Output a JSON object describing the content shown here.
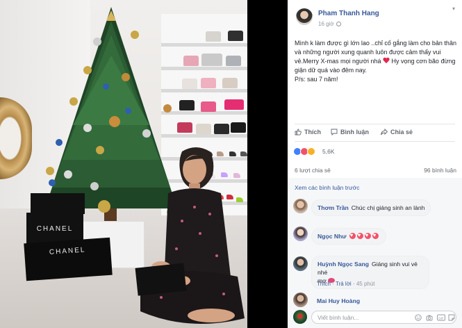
{
  "post": {
    "author": "Pham Thanh Hang",
    "time": "16 giờ",
    "body_lines": [
      "Mình k làm được gì lớn lao ..chỉ cố gắng làm cho bản thân và những người xung quanh luôn được cảm thấy vui vẻ.Merry X-mas mọi người nhá",
      "Hy vọng cơn bão đừng giận dữ quá vào đêm nay.",
      "P/s: sau 7 năm!"
    ],
    "photo_box_labels": [
      "CHANEL",
      "CHANEL"
    ]
  },
  "actions": {
    "like": "Thích",
    "comment": "Bình luận",
    "share": "Chia sẻ"
  },
  "reactions": {
    "count": "5,6K"
  },
  "stats": {
    "shares": "6 lượt chia sẻ",
    "comments": "96 bình luận"
  },
  "comments": {
    "view_previous": "Xem các bình luận trước",
    "reply_label": "Trả lời",
    "like_label": "Thích",
    "items": [
      {
        "name": "Thơm Trần",
        "text": "Chúc chị giáng sinh an lành"
      },
      {
        "name": "Ngọc Như",
        "text": ""
      },
      {
        "name": "Huỳnh Ngọc Sang",
        "text": "Giáng sinh vui vẻ nhé",
        "text2": "mợ",
        "time": "45 phút"
      },
      {
        "name": "Mai Huy Hoàng",
        "text": ""
      }
    ],
    "write_placeholder": "Viết bình luận..."
  },
  "colors": {
    "link": "#365899",
    "text": "#1d2129",
    "muted": "#606770",
    "like_blue": "#4080ff",
    "love_red": "#f25268",
    "wow_yellow": "#f7b125"
  }
}
